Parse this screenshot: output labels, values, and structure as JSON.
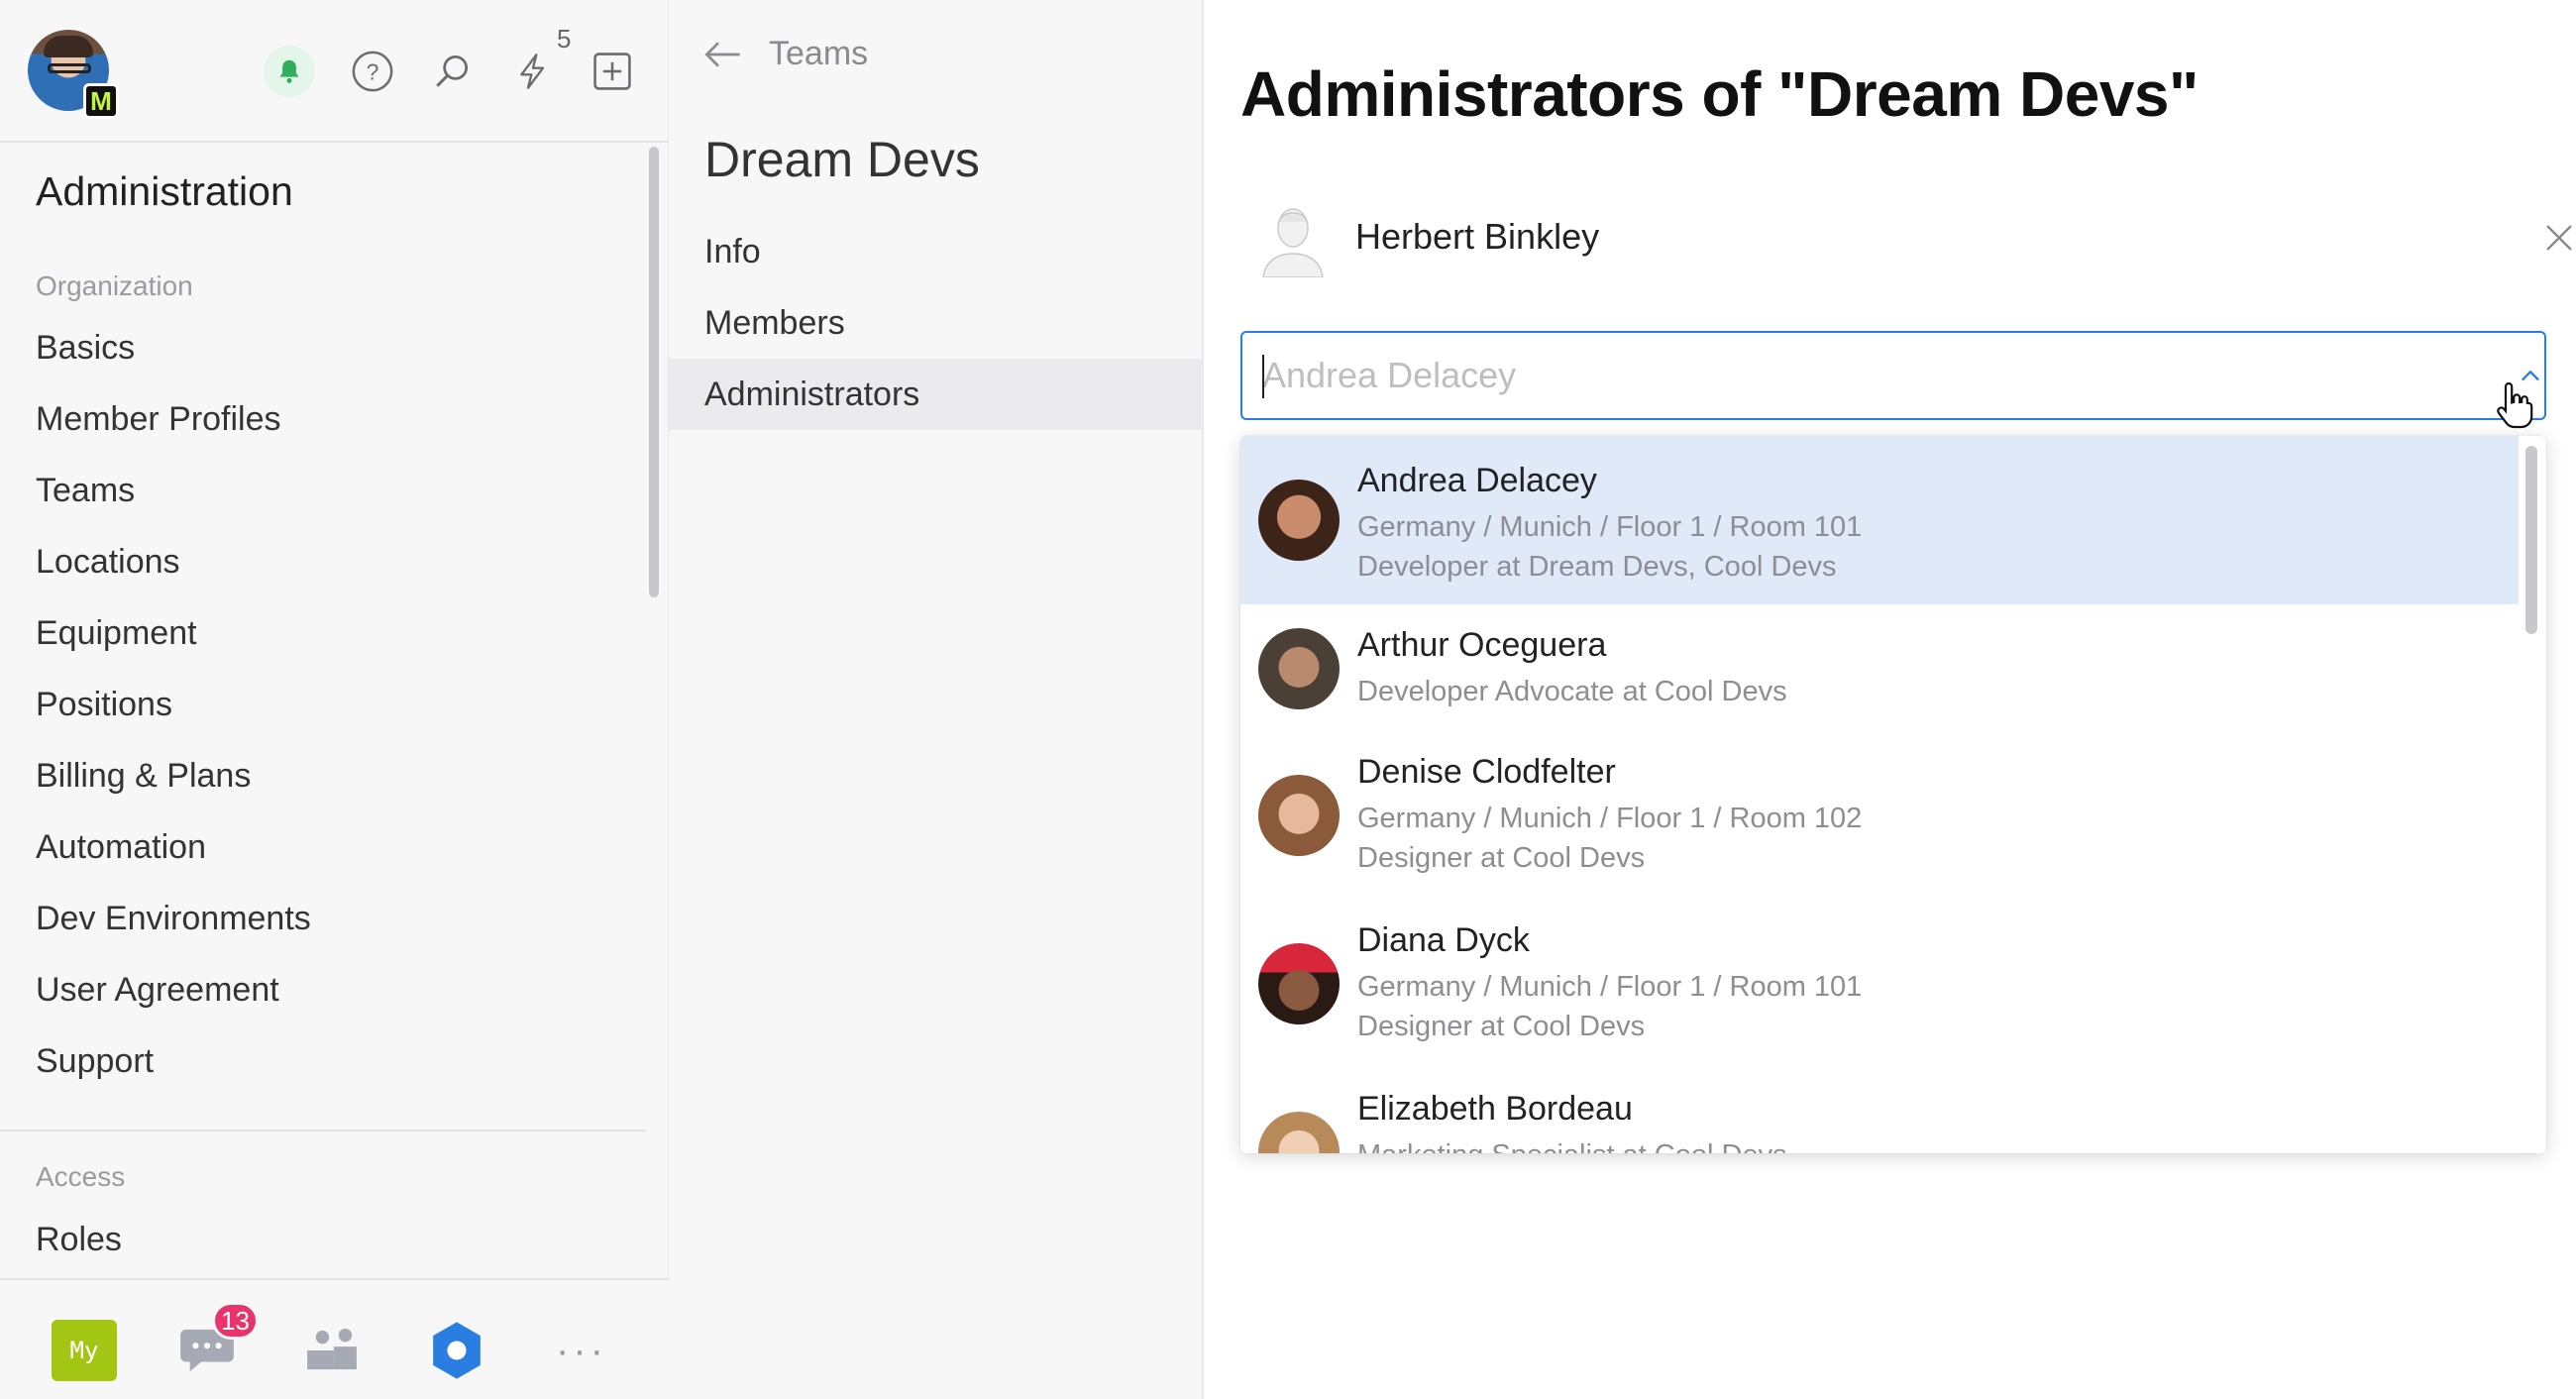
{
  "toolbar": {
    "user_badge": "M",
    "bolt_count": "5"
  },
  "sidebar": {
    "title": "Administration",
    "section_organization": "Organization",
    "items": [
      {
        "label": "Basics"
      },
      {
        "label": "Member Profiles"
      },
      {
        "label": "Teams"
      },
      {
        "label": "Locations"
      },
      {
        "label": "Equipment"
      },
      {
        "label": "Positions"
      },
      {
        "label": "Billing & Plans"
      },
      {
        "label": "Automation"
      },
      {
        "label": "Dev Environments"
      },
      {
        "label": "User Agreement"
      },
      {
        "label": "Support"
      }
    ],
    "section_access": "Access",
    "access_items": [
      {
        "label": "Roles"
      }
    ]
  },
  "bottom_bar": {
    "my_label": "My",
    "chat_count": "13",
    "more_label": "···"
  },
  "team_column": {
    "back_label": "Teams",
    "team_name": "Dream Devs",
    "nav": [
      {
        "label": "Info"
      },
      {
        "label": "Members"
      },
      {
        "label": "Administrators"
      }
    ],
    "active_nav": "Administrators"
  },
  "main": {
    "title": "Administrators of \"Dream Devs\"",
    "current_admin": {
      "name": "Herbert Binkley"
    },
    "search": {
      "placeholder": "Andrea Delacey",
      "value": ""
    },
    "options": [
      {
        "name": "Andrea Delacey",
        "location": "Germany / Munich / Floor 1 / Room 101",
        "role": "Developer at Dream Devs, Cool Devs"
      },
      {
        "name": "Arthur Oceguera",
        "location": "",
        "role": "Developer Advocate at Cool Devs"
      },
      {
        "name": "Denise Clodfelter",
        "location": "Germany / Munich / Floor 1 / Room 102",
        "role": "Designer at Cool Devs"
      },
      {
        "name": "Diana Dyck",
        "location": "Germany / Munich / Floor 1 / Room 101",
        "role": "Designer at Cool Devs"
      },
      {
        "name": "Elizabeth Bordeau",
        "location": "",
        "role": "Marketing Specialist at Cool Devs"
      }
    ]
  },
  "colors": {
    "accent": "#2a7de1",
    "highlight": "#dfe9f8",
    "my_button": "#a3c614",
    "badge": "#e8336b"
  }
}
